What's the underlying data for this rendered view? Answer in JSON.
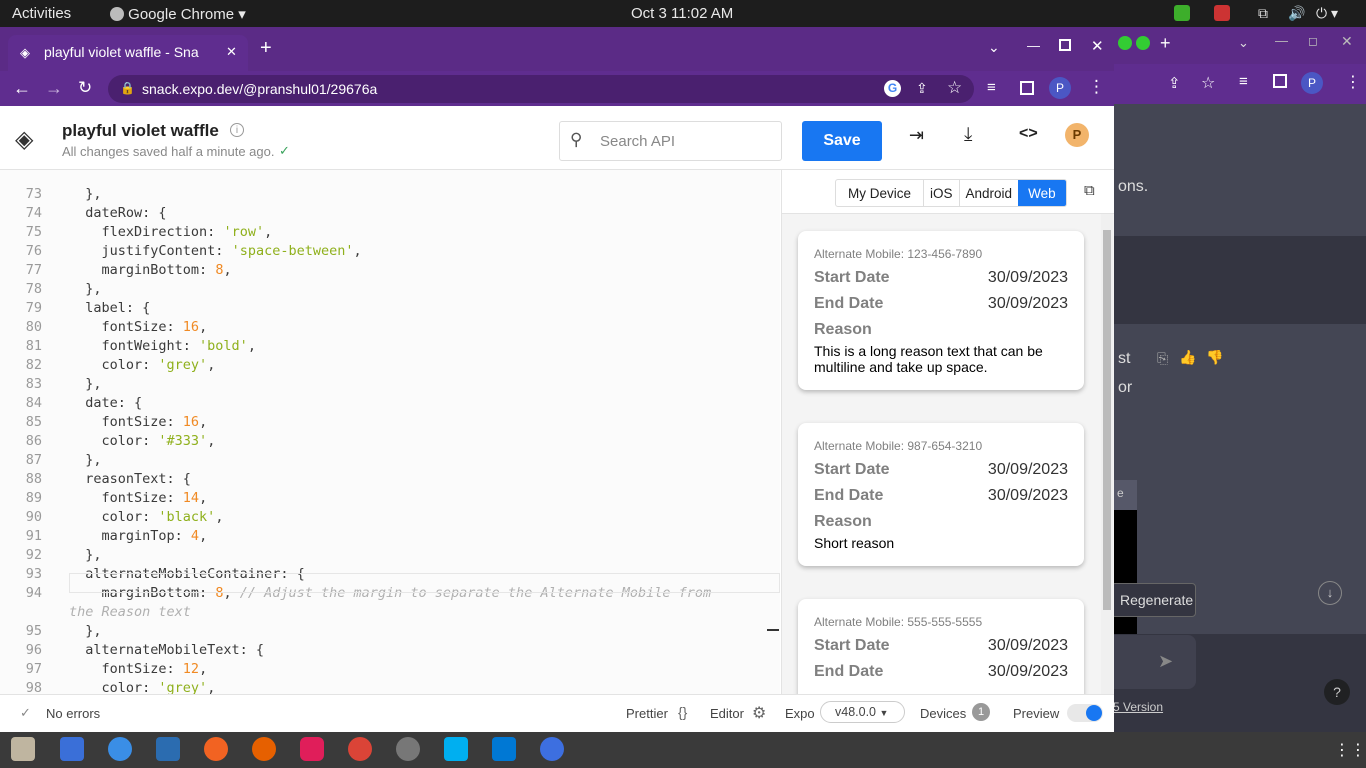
{
  "topbar": {
    "activities": "Activities",
    "app": "Google Chrome",
    "clock": "Oct 3  11:02 AM"
  },
  "tab": {
    "title": "playful violet waffle - Sna",
    "new_tab": "+"
  },
  "url": {
    "text": "snack.expo.dev/@pranshul01/29676a"
  },
  "profile_letter": "P",
  "snack": {
    "title": "playful violet waffle",
    "subtitle": "All changes saved half a minute ago.",
    "search_placeholder": "Search API",
    "save_label": "Save",
    "avatar": "P"
  },
  "device_tabs": [
    "My Device",
    "iOS",
    "Android",
    "Web"
  ],
  "code_lines": [
    {
      "n": "73",
      "t": "  },"
    },
    {
      "n": "74",
      "t": "  dateRow: {"
    },
    {
      "n": "75",
      "t": "    flexDirection: 'row',"
    },
    {
      "n": "76",
      "t": "    justifyContent: 'space-between',"
    },
    {
      "n": "77",
      "t": "    marginBottom: 8,"
    },
    {
      "n": "78",
      "t": "  },"
    },
    {
      "n": "79",
      "t": "  label: {"
    },
    {
      "n": "80",
      "t": "    fontSize: 16,"
    },
    {
      "n": "81",
      "t": "    fontWeight: 'bold',"
    },
    {
      "n": "82",
      "t": "    color: 'grey',"
    },
    {
      "n": "83",
      "t": "  },"
    },
    {
      "n": "84",
      "t": "  date: {"
    },
    {
      "n": "85",
      "t": "    fontSize: 16,"
    },
    {
      "n": "86",
      "t": "    color: '#333',"
    },
    {
      "n": "87",
      "t": "  },"
    },
    {
      "n": "88",
      "t": "  reasonText: {"
    },
    {
      "n": "89",
      "t": "    fontSize: 14,"
    },
    {
      "n": "90",
      "t": "    color: 'black',"
    },
    {
      "n": "91",
      "t": "    marginTop: 4,"
    },
    {
      "n": "92",
      "t": "  },"
    },
    {
      "n": "93",
      "t": "  alternateMobileContainer: {"
    },
    {
      "n": "94",
      "t": "    marginBottom: 8, // Adjust the margin to separate the Alternate Mobile from"
    },
    {
      "n": "",
      "t": "the Reason text"
    },
    {
      "n": "95",
      "t": "  },"
    },
    {
      "n": "96",
      "t": "  alternateMobileText: {"
    },
    {
      "n": "97",
      "t": "    fontSize: 12,"
    },
    {
      "n": "98",
      "t": "    color: 'grey',"
    }
  ],
  "cards": [
    {
      "alt": "Alternate Mobile: 123-456-7890",
      "start_label": "Start Date",
      "start": "30/09/2023",
      "end_label": "End Date",
      "end": "30/09/2023",
      "reason_label": "Reason",
      "reason": "This is a long reason text that can be multiline and take up space."
    },
    {
      "alt": "Alternate Mobile: 987-654-3210",
      "start_label": "Start Date",
      "start": "30/09/2023",
      "end_label": "End Date",
      "end": "30/09/2023",
      "reason_label": "Reason",
      "reason": "Short reason"
    },
    {
      "alt": "Alternate Mobile: 555-555-5555",
      "start_label": "Start Date",
      "start": "30/09/2023",
      "end_label": "End Date",
      "end": "30/09/2023",
      "reason_label": "",
      "reason": ""
    }
  ],
  "status": {
    "errors": "No errors",
    "prettier": "Prettier",
    "editor": "Editor",
    "expo": "Expo",
    "version": "v48.0.0",
    "devices": "Devices",
    "devices_count": "1",
    "preview": "Preview"
  },
  "bg": {
    "line1": "ons.",
    "line2": "st",
    "line3": "or",
    "regenerate": "Regenerate",
    "version_link": "5 Version",
    "chip": "e"
  }
}
